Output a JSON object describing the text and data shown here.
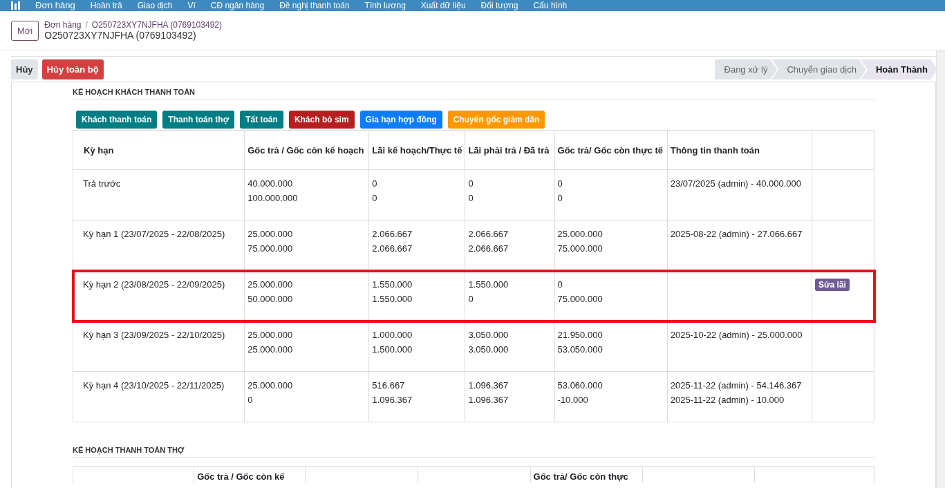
{
  "navbar": {
    "app": "Đơn hàng",
    "menu": [
      "Hoàn trả",
      "Giao dịch",
      "Ví",
      "CĐ ngân hàng",
      "Đề nghị thanh toán",
      "Tính lương",
      "Xuất dữ liệu",
      "Đối tượng",
      "Cấu hình"
    ]
  },
  "control_panel": {
    "new_button": "Mới",
    "breadcrumb": [
      "Đơn hàng",
      "O250723XY7NJFHA (0769103492)"
    ],
    "breadcrumb_separator": "/",
    "title": "O250723XY7NJFHA (0769103492)"
  },
  "actions": [
    "Hủy",
    "Hủy toàn bộ"
  ],
  "status_steps": [
    {
      "label": "Đang xử lý",
      "selected": false
    },
    {
      "label": "Chuyển giao dịch",
      "selected": false
    },
    {
      "label": "Hoàn Thành",
      "selected": true
    }
  ],
  "customer_plan": {
    "title": "KẾ HOẠCH KHÁCH THANH TOÁN",
    "buttons": [
      {
        "label": "Khách thanh toán",
        "color": "#017e84"
      },
      {
        "label": "Thanh toán thợ",
        "color": "#017e84"
      },
      {
        "label": "Tất toán",
        "color": "#017e84"
      },
      {
        "label": "Khách bỏ sim",
        "color": "#b51f1f"
      },
      {
        "label": "Gia hạn hợp đồng",
        "color": "#0b7dfb"
      },
      {
        "label": "Chuyển gốc giảm dần",
        "color": "#ff9800"
      }
    ],
    "columns": [
      "Kỳ hạn",
      "Gốc trả / Gốc còn kế hoạch",
      "Lãi kế hoạch/Thực tế",
      "Lãi phải trả / Đã trả",
      "Gốc trả/ Gốc còn thực tế",
      "Thông tin thanh toán"
    ],
    "rows": [
      {
        "term": "Trả trước",
        "principal_plan": [
          "40.000.000",
          "100.000.000"
        ],
        "interest_plan": [
          "0",
          "0"
        ],
        "interest_paid": [
          "0",
          "0"
        ],
        "principal_actual": [
          "0",
          "0"
        ],
        "payment_info": "23/07/2025 (admin) - 40.000.000",
        "highlighted": false
      },
      {
        "term": "Kỳ hạn 1 (23/07/2025 - 22/08/2025)",
        "principal_plan": [
          "25.000.000",
          "75.000.000"
        ],
        "interest_plan": [
          "2.066.667",
          "2.066.667"
        ],
        "interest_paid": [
          "2.066.667",
          "2.066.667"
        ],
        "principal_actual": [
          "25.000.000",
          "75.000.000"
        ],
        "payment_info": "2025-08-22 (admin) - 27.066.667",
        "highlighted": false
      },
      {
        "term": "Kỳ hạn 2 (23/08/2025 - 22/09/2025)",
        "principal_plan": [
          "25.000.000",
          "50.000.000"
        ],
        "interest_plan": [
          "1.550.000",
          "1.550.000"
        ],
        "interest_paid": [
          "1.550.000",
          "0"
        ],
        "principal_actual": [
          "0",
          "75.000.000"
        ],
        "action": "Sửa lãi",
        "highlighted": true
      },
      {
        "term": "Kỳ hạn 3 (23/09/2025 - 22/10/2025)",
        "principal_plan": [
          "25.000.000",
          "25.000.000"
        ],
        "interest_plan": [
          "1.000.000",
          "1.500.000"
        ],
        "interest_paid": [
          "3.050.000",
          "3.050.000"
        ],
        "principal_actual": [
          "21.950.000",
          "53.050.000"
        ],
        "payment_info": "2025-10-22 (admin) - 25.000.000",
        "highlighted": false
      },
      {
        "term": "Kỳ hạn 4 (23/10/2025 - 22/11/2025)",
        "principal_plan": [
          "25.000.000",
          "0"
        ],
        "interest_plan": [
          "516.667",
          "1.096.367"
        ],
        "interest_paid": [
          "1.096.367",
          "1.096.367"
        ],
        "principal_actual": [
          "53.060.000",
          "-10.000"
        ],
        "payment_info": "2025-11-22 (admin) - 54.146.367 2025-11-22 (admin) - 10.000",
        "highlighted": false
      }
    ]
  },
  "worker_plan": {
    "title": "KẾ HOẠCH THANH TOÁN THỢ",
    "column_2": "Gốc trả / Gốc còn kế",
    "column_5": "Gốc trả/ Gốc còn thực"
  }
}
